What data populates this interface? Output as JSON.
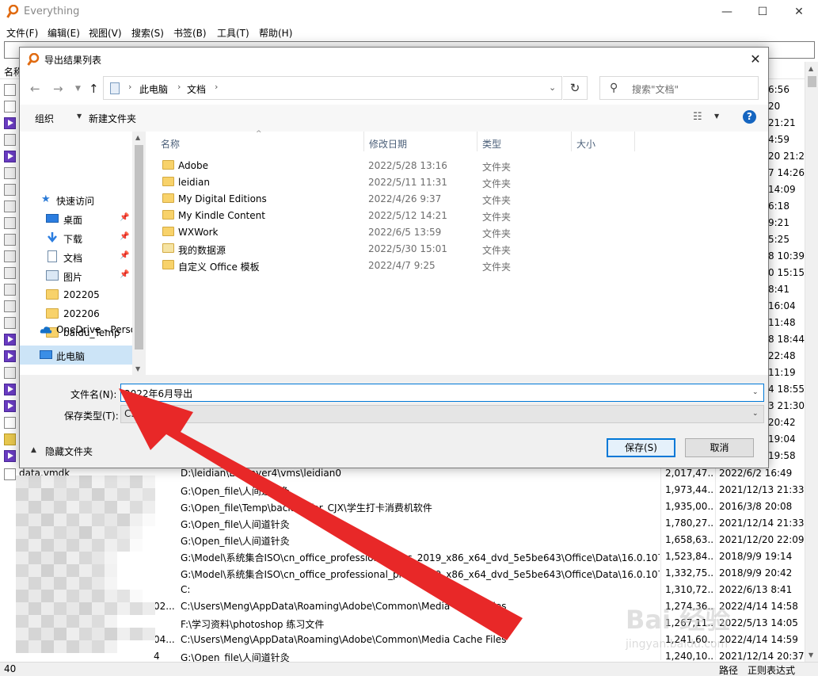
{
  "main": {
    "title": "Everything",
    "menu": [
      "文件(F)",
      "编辑(E)",
      "视图(V)",
      "搜索(S)",
      "书签(B)",
      "工具(T)",
      "帮助(H)"
    ],
    "col_name_partial": "名称",
    "times_right": [
      "6:56",
      "20",
      "21:21",
      "4:59",
      "20 21:24",
      "7 14:26",
      "14:09",
      "6:18",
      "9:21",
      "5:25",
      "8 10:39",
      "0 15:15",
      "8:41",
      "16:04",
      "11:48",
      "8 18:44",
      "22:48",
      "11:19",
      "4 18:55",
      "3 21:30",
      "20:42",
      "19:04",
      "19:58"
    ],
    "rows": [
      {
        "name": "data.vmdk",
        "prefix": "",
        "path": "D:\\leidian\\LDPlayer4\\vms\\leidian0",
        "size": "2,017,47...",
        "date": "2022/6/2 16:49"
      },
      {
        "name": "",
        "prefix": "",
        "path": "G:\\Open_file\\人间道针灸",
        "size": "1,973,44...",
        "date": "2021/12/13 21:33"
      },
      {
        "name": "",
        "prefix": "",
        "path": "G:\\Open_file\\Temp\\backup_for_CJX\\学生打卡消费机软件",
        "size": "1,935,00...",
        "date": "2016/3/8 20:08"
      },
      {
        "name": "",
        "prefix": "",
        "path": "G:\\Open_file\\人间道针灸",
        "size": "1,780,27...",
        "date": "2021/12/14 21:33"
      },
      {
        "name": "",
        "prefix": "",
        "path": "G:\\Open_file\\人间道针灸",
        "size": "1,658,63...",
        "date": "2021/12/20 22:09"
      },
      {
        "name": "",
        "prefix": "",
        "path": "G:\\Model\\系统集合ISO\\cn_office_professional_plus_2019_x86_x64_dvd_5e5be643\\Office\\Data\\16.0.1073...",
        "size": "1,523,84...",
        "date": "2018/9/9 19:14"
      },
      {
        "name": "",
        "prefix": "",
        "path": "G:\\Model\\系统集合ISO\\cn_office_professional_plus_2019_x86_x64_dvd_5e5be643\\Office\\Data\\16.0.1073...",
        "size": "1,332,75...",
        "date": "2018/9/9 20:42"
      },
      {
        "name": "",
        "prefix": "",
        "path": "C:",
        "size": "1,310,72...",
        "date": "2022/6/13 8:41"
      },
      {
        "name": "",
        "prefix": "02...",
        "path": "C:\\Users\\Meng\\AppData\\Roaming\\Adobe\\Common\\Media Cache Files",
        "size": "1,274,36...",
        "date": "2022/4/14 14:58"
      },
      {
        "name": "",
        "prefix": "",
        "path": "F:\\学习资料\\photoshop  练习文件",
        "size": "1,267,11...",
        "date": "2022/5/13 14:05"
      },
      {
        "name": "",
        "prefix": "04...",
        "path": "C:\\Users\\Meng\\AppData\\Roaming\\Adobe\\Common\\Media Cache Files",
        "size": "1,241,60...",
        "date": "2022/4/14 14:59"
      },
      {
        "name": "",
        "prefix": "4",
        "path": "G:\\Open_file\\人间道针灸",
        "size": "1,240,10...",
        "date": "2021/12/14 20:37"
      }
    ],
    "status_left": "40",
    "status_path": "路径",
    "status_regex": "正则表达式"
  },
  "dialog": {
    "title": "导出结果列表",
    "close": "✕",
    "address": {
      "root": "此电脑",
      "folder": "文档"
    },
    "search_placeholder": "搜索\"文档\"",
    "toolbar": {
      "organize": "组织",
      "new_folder": "新建文件夹",
      "help": "?"
    },
    "nav": [
      {
        "label": "快速访问",
        "icon": "star-icon",
        "pinned": false
      },
      {
        "label": "桌面",
        "icon": "desktop-icon",
        "pinned": true
      },
      {
        "label": "下载",
        "icon": "download-icon",
        "pinned": true
      },
      {
        "label": "文档",
        "icon": "document-icon",
        "pinned": true
      },
      {
        "label": "图片",
        "icon": "picture-icon",
        "pinned": true
      },
      {
        "label": "202205",
        "icon": "folder-icon",
        "pinned": false
      },
      {
        "label": "202206",
        "icon": "folder-icon",
        "pinned": false
      },
      {
        "label": "baidu_Temp",
        "icon": "folder-icon",
        "pinned": false
      },
      {
        "label": "google_downlo",
        "icon": "folder-icon",
        "pinned": false
      },
      {
        "label": "OneDrive - Perso",
        "icon": "onedrive-icon",
        "pinned": false
      },
      {
        "label": "此电脑",
        "icon": "computer-icon",
        "pinned": false
      }
    ],
    "columns": {
      "name": "名称",
      "modified": "修改日期",
      "type": "类型",
      "size": "大小"
    },
    "files": [
      {
        "name": "Adobe",
        "date": "2022/5/28 13:16",
        "type": "文件夹"
      },
      {
        "name": "leidian",
        "date": "2022/5/11 11:31",
        "type": "文件夹"
      },
      {
        "name": "My Digital Editions",
        "date": "2022/4/26 9:37",
        "type": "文件夹"
      },
      {
        "name": "My Kindle Content",
        "date": "2022/5/12 14:21",
        "type": "文件夹"
      },
      {
        "name": "WXWork",
        "date": "2022/6/5 13:59",
        "type": "文件夹"
      },
      {
        "name": "我的数据源",
        "date": "2022/5/30 15:01",
        "type": "文件夹"
      },
      {
        "name": "自定义 Office 模板",
        "date": "2022/4/7 9:25",
        "type": "文件夹"
      }
    ],
    "form": {
      "filename_label": "文件名(N):",
      "filename_value": "2022年6月导出",
      "filetype_label": "保存类型(T):",
      "filetype_value": "CSV (*.csv)",
      "hide_folders": "隐藏文件夹",
      "save": "保存(S)",
      "cancel": "取消"
    }
  },
  "watermark": {
    "text": "Bai 经验",
    "sub": "jingyan.baidu.com"
  },
  "colors": {
    "accent": "#0078d7",
    "arrow": "#e82828",
    "selected": "#cce4f7"
  }
}
